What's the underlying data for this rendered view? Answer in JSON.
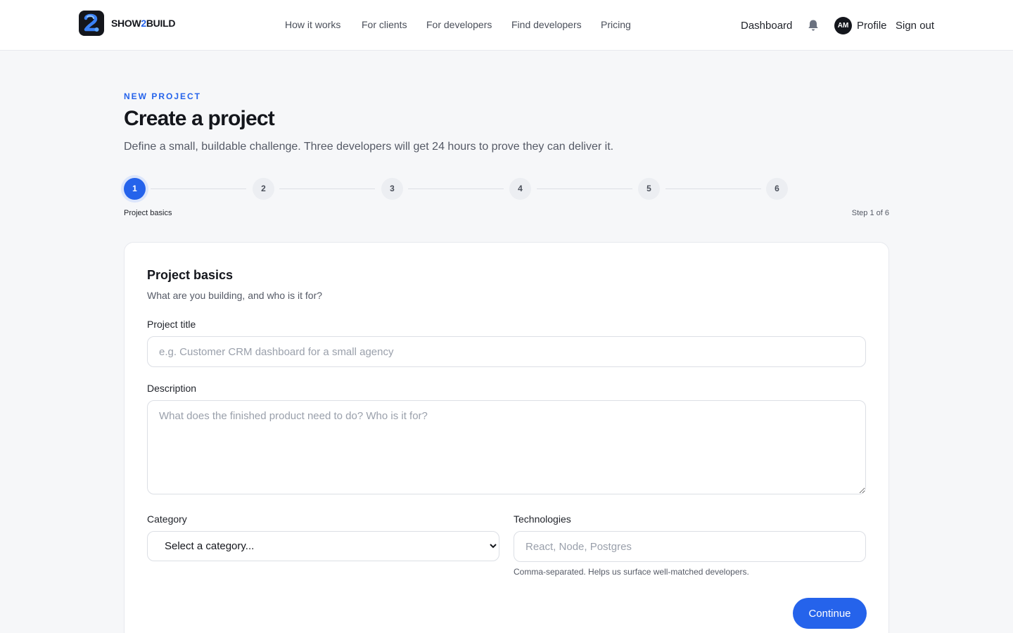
{
  "brand": {
    "name_part1": "SHOW",
    "name_accent": "2",
    "name_part2": "BUILD"
  },
  "nav": {
    "items": [
      {
        "label": "How it works"
      },
      {
        "label": "For clients"
      },
      {
        "label": "For developers"
      },
      {
        "label": "Find developers"
      },
      {
        "label": "Pricing"
      }
    ]
  },
  "header_right": {
    "dashboard": "Dashboard",
    "notifications_icon": "bell-icon",
    "avatar_initials": "AM",
    "profile": "Profile",
    "sign_out": "Sign out"
  },
  "intro": {
    "eyebrow": "NEW PROJECT",
    "title": "Create a project",
    "subtitle": "Define a small, buildable challenge. Three developers will get 24 hours to prove they can deliver it."
  },
  "stepper": {
    "steps": [
      "1",
      "2",
      "3",
      "4",
      "5",
      "6"
    ],
    "current_index": 0,
    "current_label": "Project basics",
    "progress_text": "Step 1 of 6"
  },
  "form": {
    "title": "Project basics",
    "subtitle": "What are you building, and who is it for?",
    "project_title": {
      "label": "Project title",
      "value": "",
      "placeholder": "e.g. Customer CRM dashboard for a small agency"
    },
    "description": {
      "label": "Description",
      "value": "",
      "placeholder": "What does the finished product need to do? Who is it for?"
    },
    "category": {
      "label": "Category",
      "selected": "Select a category..."
    },
    "technologies": {
      "label": "Technologies",
      "value": "",
      "placeholder": "React, Node, Postgres",
      "hint": "Comma-separated. Helps us surface well-matched developers."
    },
    "continue_label": "Continue"
  },
  "colors": {
    "accent": "#2563eb",
    "background": "#f6f7f9",
    "text": "#14161c"
  }
}
